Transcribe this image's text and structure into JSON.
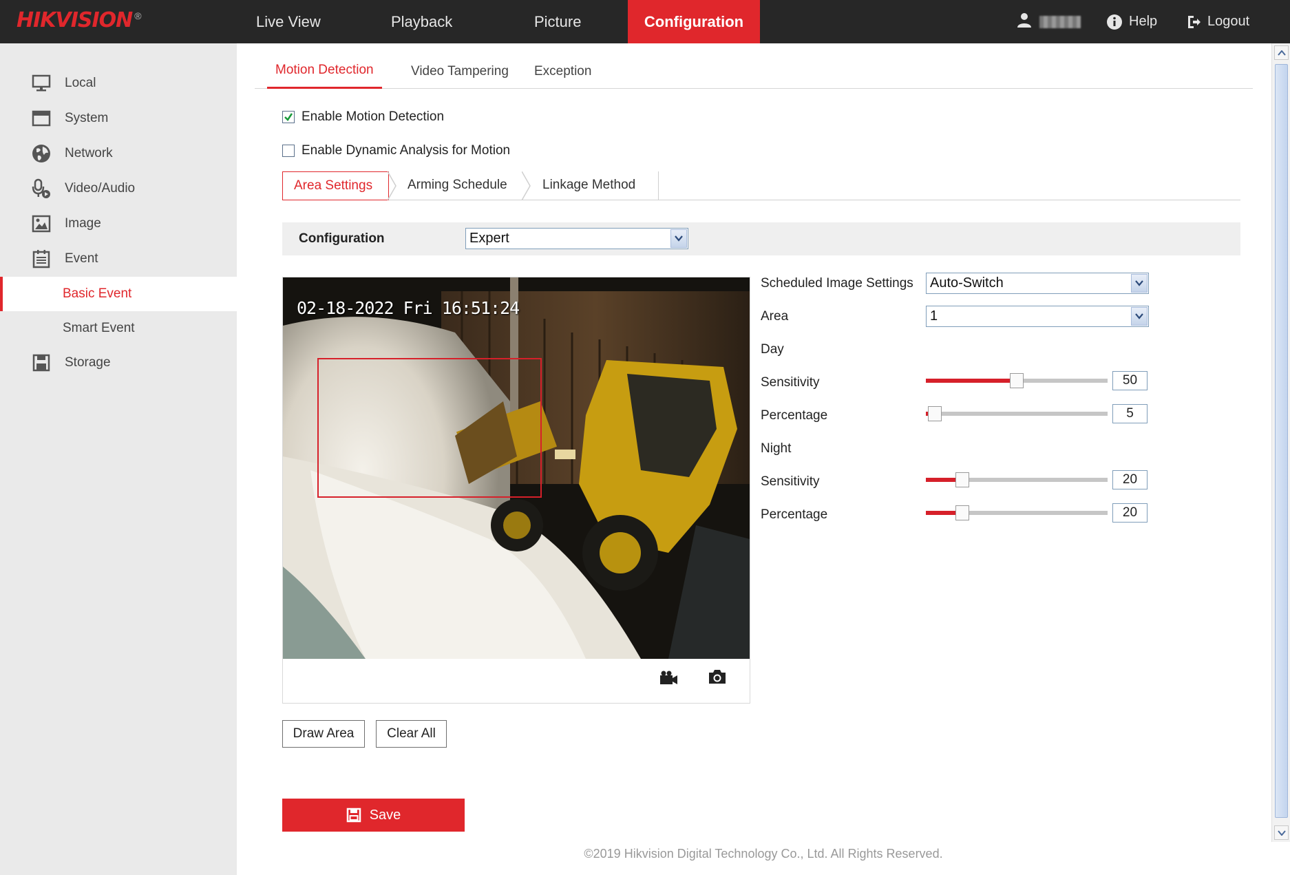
{
  "brand": {
    "logo_text": "HIKVISION",
    "registered_mark": "®",
    "accent_color": "#e0272c"
  },
  "top_nav": {
    "items": [
      {
        "label": "Live View"
      },
      {
        "label": "Playback"
      },
      {
        "label": "Picture"
      },
      {
        "label": "Configuration",
        "active": true
      }
    ],
    "help_label": "Help",
    "logout_label": "Logout"
  },
  "sidebar": {
    "items": [
      {
        "label": "Local",
        "icon": "monitor-icon"
      },
      {
        "label": "System",
        "icon": "window-icon"
      },
      {
        "label": "Network",
        "icon": "globe-icon"
      },
      {
        "label": "Video/Audio",
        "icon": "microphone-icon"
      },
      {
        "label": "Image",
        "icon": "image-icon"
      },
      {
        "label": "Event",
        "icon": "calendar-icon"
      }
    ],
    "sub_items": [
      {
        "label": "Basic Event",
        "active": true
      },
      {
        "label": "Smart Event"
      }
    ],
    "storage": {
      "label": "Storage",
      "icon": "floppy-icon"
    }
  },
  "tabs": [
    {
      "label": "Motion Detection",
      "active": true
    },
    {
      "label": "Video Tampering"
    },
    {
      "label": "Exception"
    }
  ],
  "options": {
    "enable_motion": {
      "label": "Enable Motion Detection",
      "checked": true
    },
    "enable_dynamic": {
      "label": "Enable Dynamic Analysis for Motion",
      "checked": false
    }
  },
  "steps": [
    {
      "label": "Area Settings",
      "active": true
    },
    {
      "label": "Arming Schedule"
    },
    {
      "label": "Linkage Method"
    }
  ],
  "configuration": {
    "label": "Configuration",
    "value": "Expert"
  },
  "video": {
    "osd_text": "02-18-2022 Fri 16:51:24",
    "record_icon": "video-record-icon",
    "snapshot_icon": "camera-icon"
  },
  "params": {
    "scheduled_label": "Scheduled Image Settings",
    "scheduled_value": "Auto-Switch",
    "area_label": "Area",
    "area_value": "1",
    "day_label": "Day",
    "night_label": "Night",
    "day_sensitivity": {
      "label": "Sensitivity",
      "value": "50"
    },
    "day_percentage": {
      "label": "Percentage",
      "value": "5"
    },
    "night_sensitivity": {
      "label": "Sensitivity",
      "value": "20"
    },
    "night_percentage": {
      "label": "Percentage",
      "value": "20"
    }
  },
  "buttons": {
    "draw_area": "Draw Area",
    "clear_all": "Clear All",
    "save": "Save"
  },
  "footer": "©2019 Hikvision Digital Technology Co., Ltd. All Rights Reserved."
}
